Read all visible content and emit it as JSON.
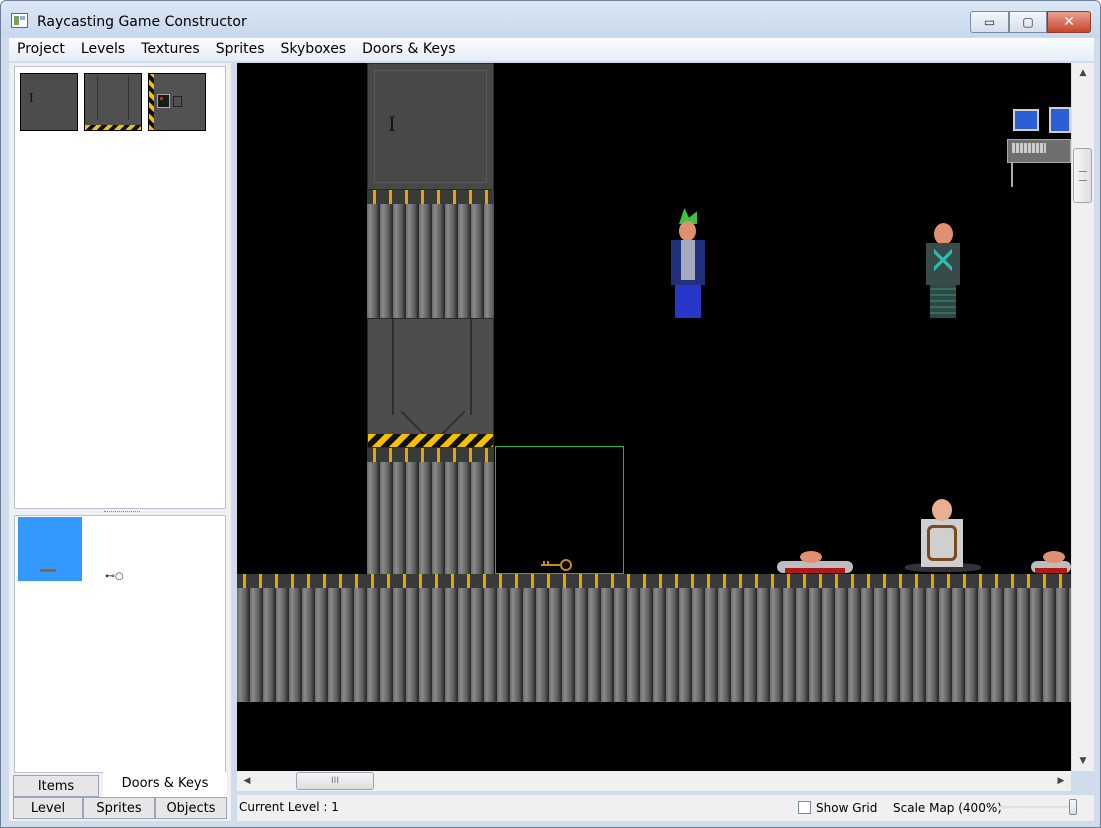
{
  "window": {
    "title": "Raycasting Game Constructor",
    "close_glyph": "✕",
    "minimize_glyph": "▭",
    "maximize_glyph": "▢"
  },
  "menu": [
    "Project",
    "Levels",
    "Textures",
    "Sprites",
    "Skyboxes",
    "Doors & Keys"
  ],
  "left_panel": {
    "textures": [
      {
        "icon": "door-plate-icon"
      },
      {
        "icon": "chevron-door-icon"
      },
      {
        "icon": "hazard-panel-door-icon"
      }
    ],
    "keys": [
      {
        "icon": "key-icon",
        "selected": true
      },
      {
        "icon": "key-icon",
        "selected": false
      }
    ],
    "tabs_row1": [
      "Items",
      "Doors & Keys"
    ],
    "tabs_row1_active": "Doors & Keys",
    "tabs_row2": [
      "Level",
      "Sprites",
      "Objects"
    ]
  },
  "map": {
    "selection_color": "#2fb52f",
    "sprites": [
      "npc-punk",
      "npc-bald",
      "npc-tied",
      "corpse",
      "corpse",
      "computer-terminal",
      "key"
    ]
  },
  "scroll": {
    "up": "▲",
    "down": "▼",
    "left": "◀",
    "right": "▶",
    "hthumb_grip": "III"
  },
  "status": {
    "current_level": "Current Level : 1",
    "show_grid_label": "Show Grid",
    "show_grid_checked": false,
    "scale_label": "Scale Map (400%)"
  }
}
